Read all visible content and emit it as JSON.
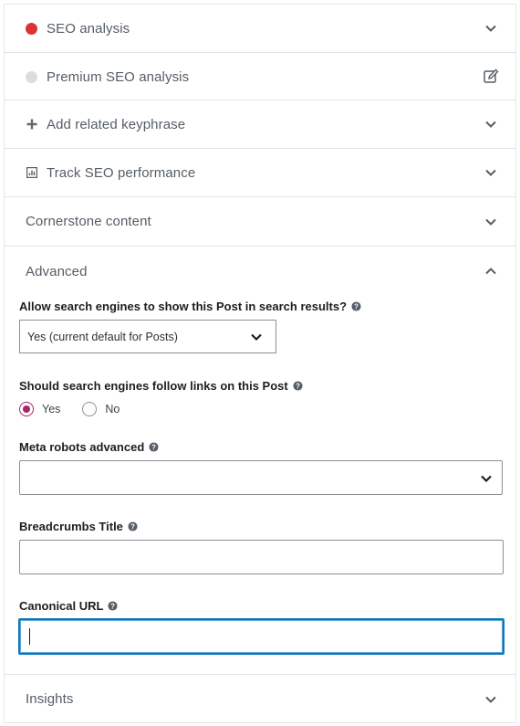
{
  "sections": [
    {
      "id": "seo-analysis",
      "title": "SEO analysis",
      "icon": "red-dot-bullet",
      "bullet_color": "#dc3232",
      "action_icon": "chevron-down-icon"
    },
    {
      "id": "premium-seo-analysis",
      "title": "Premium SEO analysis",
      "icon": "grey-dot-bullet",
      "bullet_color": "#dcdcde",
      "action_icon": "edit-icon"
    },
    {
      "id": "add-related-keyphrase",
      "title": "Add related keyphrase",
      "icon": "plus-icon",
      "action_icon": "chevron-down-icon"
    },
    {
      "id": "track-seo-performance",
      "title": "Track SEO performance",
      "icon": "chart-icon",
      "action_icon": "chevron-down-icon"
    },
    {
      "id": "cornerstone-content",
      "title": "Cornerstone content",
      "action_icon": "chevron-down-icon"
    },
    {
      "id": "advanced",
      "title": "Advanced",
      "action_icon": "chevron-up-icon",
      "expanded": true
    },
    {
      "id": "insights",
      "title": "Insights",
      "action_icon": "chevron-down-icon"
    }
  ],
  "advanced": {
    "search_results_label": "Allow search engines to show this Post in search results?",
    "search_results_value": "Yes (current default for Posts)",
    "follow_links_label": "Should search engines follow links on this Post",
    "follow_links_options": [
      {
        "label": "Yes",
        "checked": true
      },
      {
        "label": "No",
        "checked": false
      }
    ],
    "meta_robots_label": "Meta robots advanced",
    "meta_robots_value": "",
    "breadcrumbs_label": "Breadcrumbs Title",
    "breadcrumbs_value": "",
    "canonical_label": "Canonical URL",
    "canonical_value": ""
  },
  "colors": {
    "accent_radio": "#a4286a",
    "focus_border": "#0f75bc",
    "seo_bullet": "#dc3232",
    "premium_bullet": "#dcdcde"
  }
}
